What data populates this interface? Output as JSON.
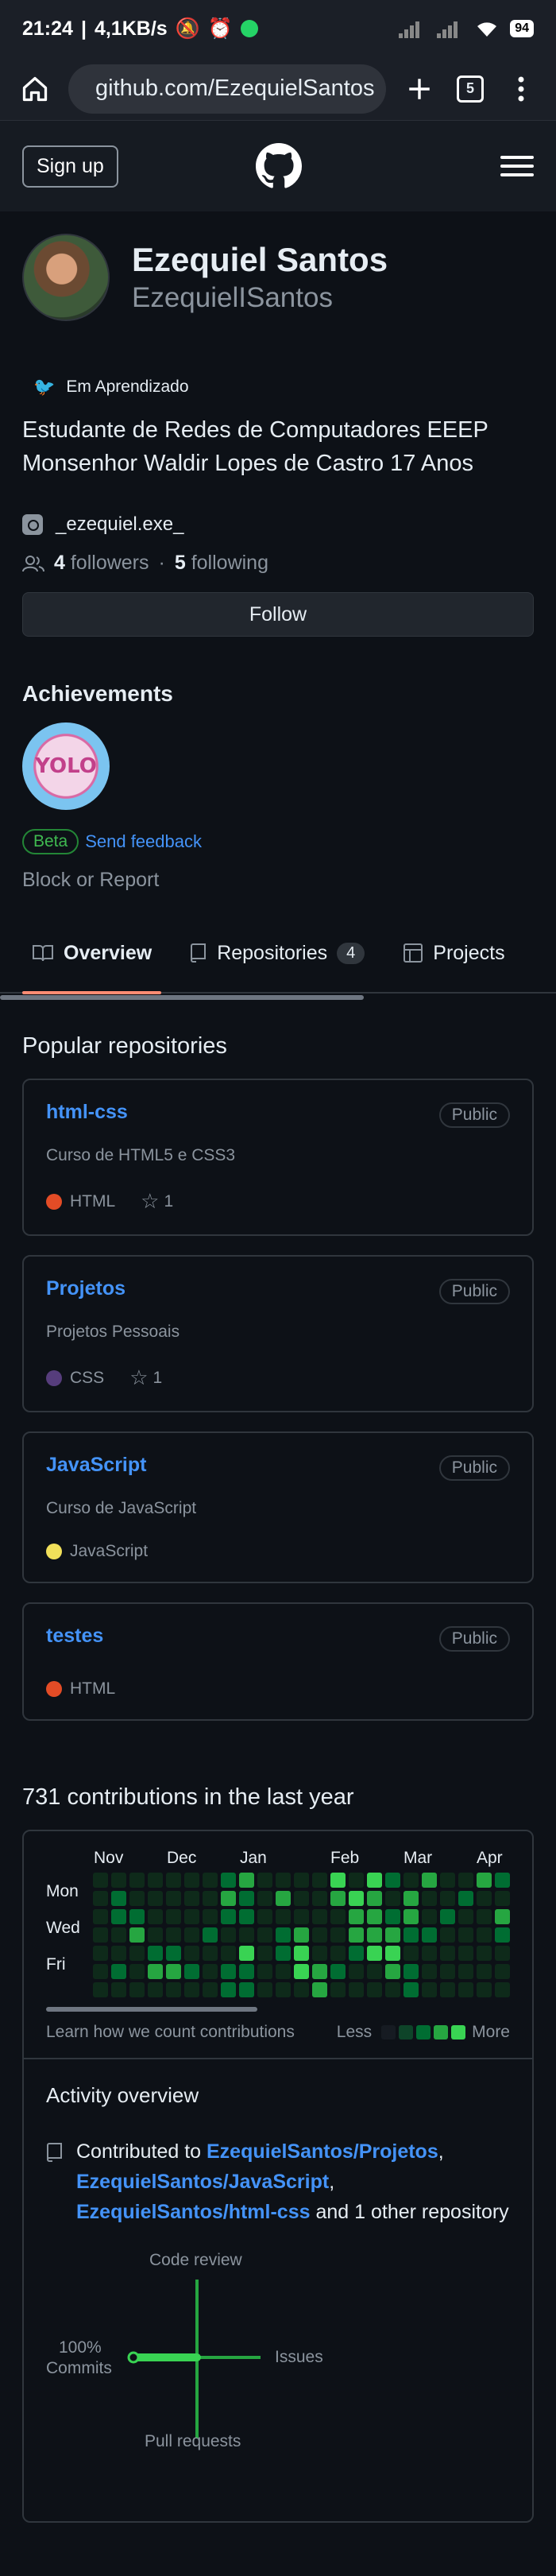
{
  "statusbar": {
    "time": "21:24",
    "speed": "4,1KB/s",
    "battery": "94"
  },
  "browser": {
    "url": "github.com/EzequielSantos",
    "tab_count": "5"
  },
  "header": {
    "signup_label": "Sign up"
  },
  "profile": {
    "full_name": "Ezequiel Santos",
    "username": "EzequielISantos",
    "status_text": "Em Aprendizado",
    "bio": "Estudante de Redes de Computadores EEEP Monsenhor Waldir Lopes de Castro 17 Anos",
    "social": "_ezequiel.exe_",
    "followers_count": "4",
    "followers_label": "followers",
    "sep": "·",
    "following_count": "5",
    "following_label": "following",
    "follow_label": "Follow"
  },
  "achievements": {
    "title": "Achievements",
    "beta_label": "Beta",
    "feedback_label": "Send feedback",
    "block_label": "Block or Report"
  },
  "tabs": [
    {
      "label": "Overview"
    },
    {
      "label": "Repositories",
      "count": "4"
    },
    {
      "label": "Projects"
    }
  ],
  "popular": {
    "title": "Popular repositories",
    "repos": [
      {
        "name": "html-css",
        "visibility": "Public",
        "description": "Curso de HTML5 e CSS3",
        "language": "HTML",
        "color": "#e34c26",
        "stars": "1"
      },
      {
        "name": "Projetos",
        "visibility": "Public",
        "description": "Projetos Pessoais",
        "language": "CSS",
        "color": "#563d7c",
        "stars": "1"
      },
      {
        "name": "JavaScript",
        "visibility": "Public",
        "description": "Curso de JavaScript",
        "language": "JavaScript",
        "color": "#f1e05a"
      },
      {
        "name": "testes",
        "visibility": "Public",
        "description": "",
        "language": "HTML",
        "color": "#e34c26"
      }
    ]
  },
  "contributions": {
    "title": "731 contributions in the last year",
    "months": [
      "Nov",
      "Dec",
      "Jan",
      "Feb",
      "Mar",
      "Apr"
    ],
    "days": [
      "Mon",
      "Wed",
      "Fri"
    ],
    "learn": "Learn how we count contributions",
    "less": "Less",
    "more": "More",
    "colors": [
      "#161b22",
      "#0e4429",
      "#006d32",
      "#26a641",
      "#39d353"
    ]
  },
  "activity": {
    "title": "Activity overview",
    "prefix": "Contributed to",
    "repo1": "EzequielSantos/Projetos",
    "repo2": "EzequielSantos/JavaScript",
    "repo3": "EzequielSantos/html-css",
    "suffix": "and 1 other repository",
    "code_review": "Code review",
    "issues": "Issues",
    "pull_requests": "Pull requests",
    "commits_pct": "100%",
    "commits": "Commits"
  }
}
